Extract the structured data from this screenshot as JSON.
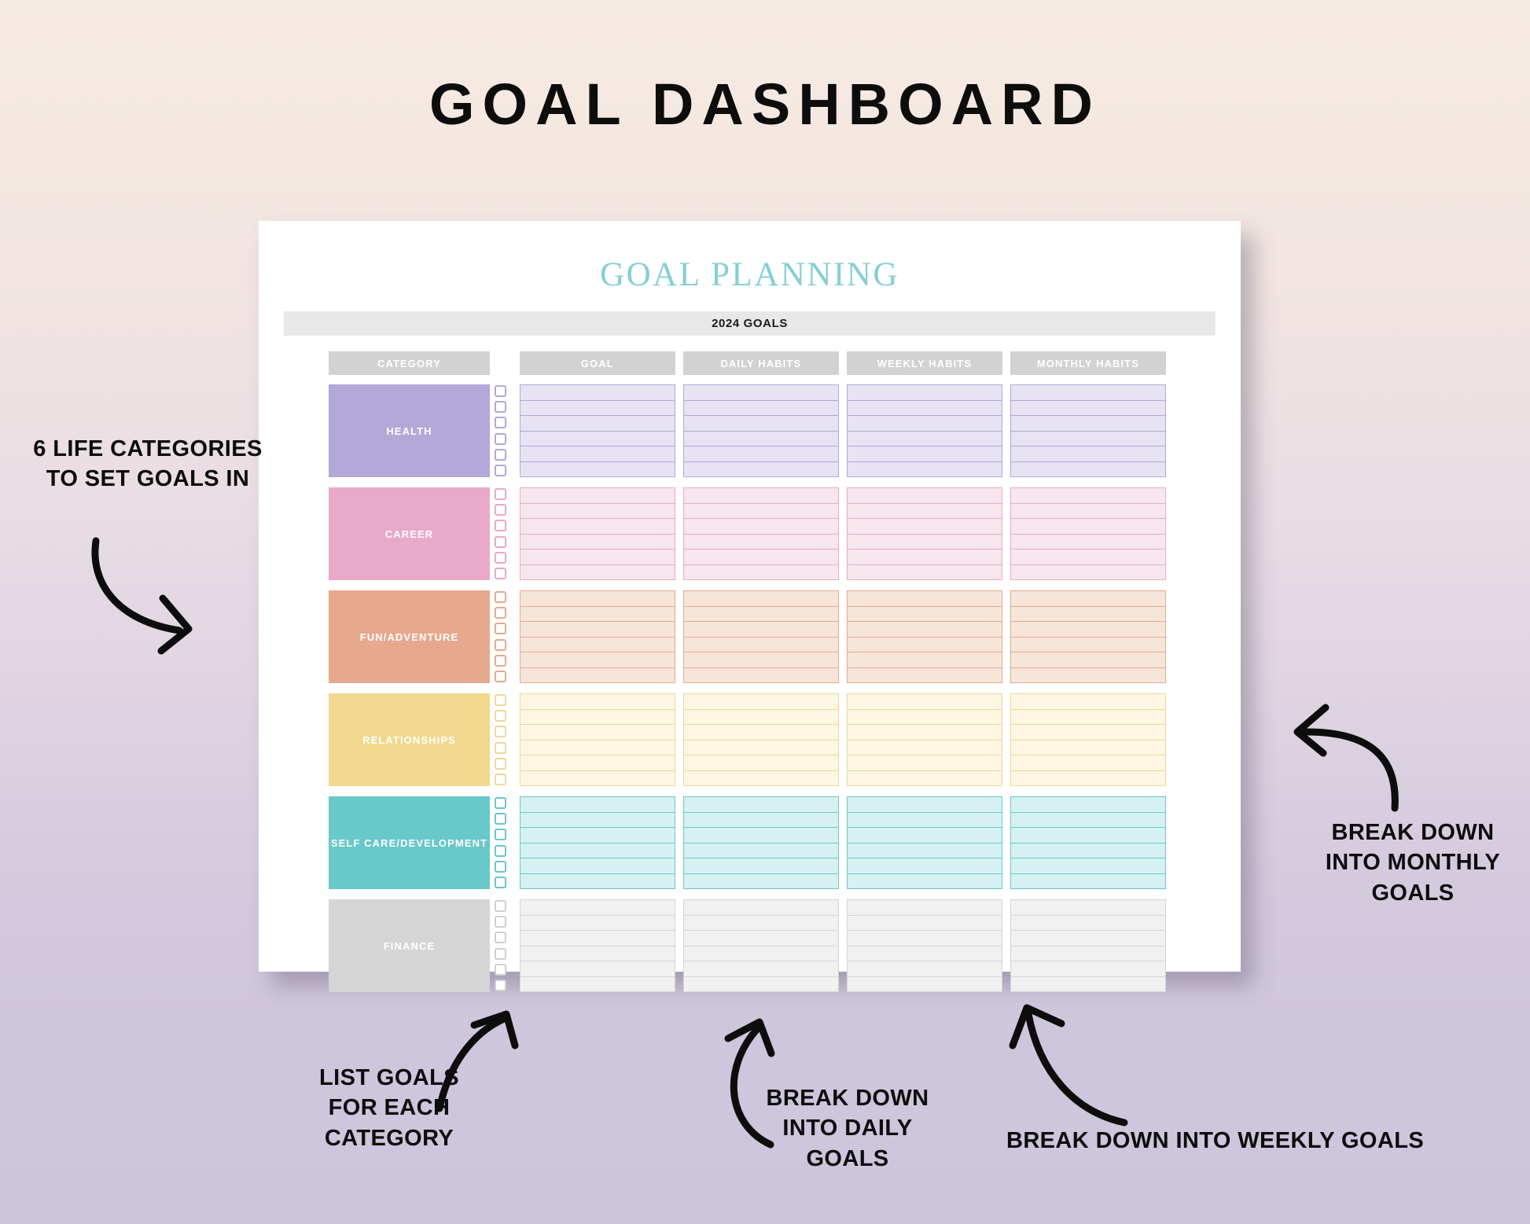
{
  "page": {
    "title": "GOAL DASHBOARD"
  },
  "sheet": {
    "title": "GOAL PLANNING",
    "year_bar": "2024 GOALS",
    "columns": [
      "CATEGORY",
      "GOAL",
      "DAILY HABITS",
      "WEEKLY HABITS",
      "MONTHLY HABITS"
    ],
    "rows_per_block": 6,
    "checkboxes_per_row": 6,
    "categories": [
      {
        "label": "HEALTH",
        "swatch": "#b3a8d8",
        "fill": "#e7e3f3",
        "border": "#b3a8d8",
        "check_border": "#b3a8d8"
      },
      {
        "label": "CAREER",
        "swatch": "#e9a9c8",
        "fill": "#f8e6ee",
        "border": "#e9a9c8",
        "check_border": "#e9a9c8"
      },
      {
        "label": "FUN/ADVENTURE",
        "swatch": "#e6a98e",
        "fill": "#f7e5da",
        "border": "#e6a98e",
        "check_border": "#e6a98e"
      },
      {
        "label": "RELATIONSHIPS",
        "swatch": "#f2d88d",
        "fill": "#fdf6e2",
        "border": "#f0d79a",
        "check_border": "#f0d79a"
      },
      {
        "label": "SELF CARE/DEVELOPMENT",
        "swatch": "#69c8c9",
        "fill": "#d6f1f2",
        "border": "#69c8c9",
        "check_border": "#69c8c9"
      },
      {
        "label": "FINANCE",
        "swatch": "#d5d5d5",
        "fill": "#f1f1f1",
        "border": "#d5d5d5",
        "check_border": "#cfcfcf"
      }
    ],
    "header_bg": "#d2d2d2",
    "header_text_color": "#ffffff",
    "title_color": "#84cfd4"
  },
  "annotations": {
    "left": "6 LIFE CATEGORIES TO SET GOALS IN",
    "right": "BREAK DOWN INTO MONTHLY GOALS",
    "list_goals": "LIST GOALS FOR EACH CATEGORY",
    "daily": "BREAK DOWN INTO DAILY GOALS",
    "weekly": "BREAK DOWN INTO WEEKLY GOALS"
  },
  "colors": {
    "background_top": "#f6ebe2",
    "background_bottom": "#ccc5dc",
    "text": "#0d0d0d"
  }
}
